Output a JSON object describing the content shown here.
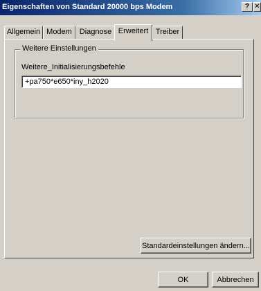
{
  "window": {
    "title": "Eigenschaften von Standard 20000 bps Modem",
    "help_label": "?",
    "close_label": "✕"
  },
  "tabs": [
    {
      "label": "Allgemein"
    },
    {
      "label": "Modem"
    },
    {
      "label": "Diagnose"
    },
    {
      "label": "Erweitert",
      "active": true
    },
    {
      "label": "Treiber"
    }
  ],
  "advanced": {
    "group_title": "Weitere Einstellungen",
    "field_label": "Weitere_Initialisierungsbefehle",
    "field_value": "+pa750*e650*iny_h2020"
  },
  "buttons": {
    "change_defaults": "Standardeinstellungen ändern...",
    "ok": "OK",
    "cancel": "Abbrechen"
  },
  "colors": {
    "titlebar_start": "#0a246a",
    "titlebar_end": "#a6caf0",
    "face": "#d4d0c8"
  }
}
